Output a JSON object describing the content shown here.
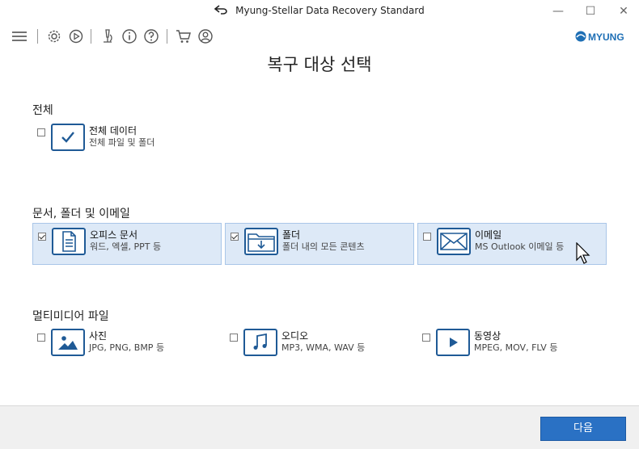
{
  "window": {
    "title": "Myung-Stellar Data Recovery Standard",
    "controls": {
      "minimize": "—",
      "maximize": "☐",
      "close": "✕"
    }
  },
  "brand": {
    "logo_text": "MYUNG"
  },
  "page": {
    "heading": "복구 대상 선택"
  },
  "sections": [
    {
      "title": "전체",
      "items": [
        {
          "label": "전체 데이터",
          "desc": "전체 파일 및 폴더",
          "checked": false,
          "icon": "check-icon"
        }
      ]
    },
    {
      "title": "문서, 폴더 및 이메일",
      "items": [
        {
          "label": "오피스 문서",
          "desc": "워드, 엑셀, PPT 등",
          "checked": true,
          "icon": "document-icon"
        },
        {
          "label": "폴더",
          "desc": "폴더 내의 모든 콘텐츠",
          "checked": true,
          "icon": "folder-icon"
        },
        {
          "label": "이메일",
          "desc": "MS Outlook 이메일 등",
          "checked": false,
          "icon": "envelope-icon"
        }
      ]
    },
    {
      "title": "멀티미디어 파일",
      "items": [
        {
          "label": "사진",
          "desc": "JPG, PNG, BMP 등",
          "checked": false,
          "icon": "photo-icon"
        },
        {
          "label": "오디오",
          "desc": "MP3, WMA, WAV 등",
          "checked": false,
          "icon": "music-note-icon"
        },
        {
          "label": "동영상",
          "desc": "MPEG, MOV, FLV 등",
          "checked": false,
          "icon": "play-icon"
        }
      ]
    }
  ],
  "footer": {
    "next_label": "다음"
  },
  "colors": {
    "accent": "#2a71c4",
    "icon_border": "#1f5a96",
    "selected_bg": "#dde9f7"
  }
}
